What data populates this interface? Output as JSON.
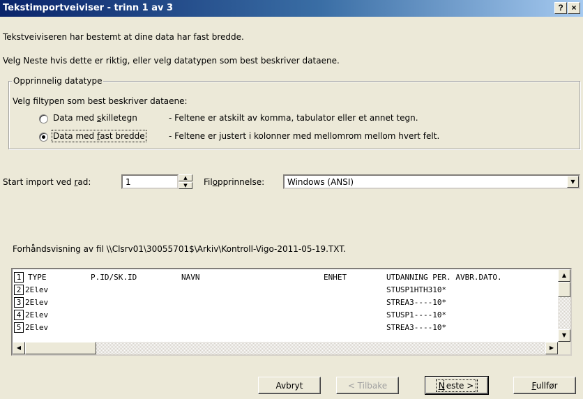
{
  "window": {
    "title": "Tekstimportveiviser - trinn 1 av 3",
    "help_label": "?",
    "close_label": "×"
  },
  "intro": {
    "line1": "Tekstveiviseren har bestemt at dine data har fast bredde.",
    "line2": "Velg Neste hvis dette er riktig, eller velg datatypen som best beskriver dataene."
  },
  "datatype_group": {
    "legend": "Opprinnelig datatype",
    "prompt": "Velg filtypen som best beskriver dataene:",
    "options": [
      {
        "label_pre": "Data med ",
        "label_mnemonic": "s",
        "label_post": "killetegn",
        "description": "- Feltene er atskilt av komma, tabulator eller et annet tegn.",
        "selected": false
      },
      {
        "label_pre": "Data med ",
        "label_mnemonic": "f",
        "label_post": "ast bredde",
        "description": "- Feltene er justert i kolonner med mellomrom mellom hvert felt.",
        "selected": true
      }
    ]
  },
  "start_row": {
    "label_pre": "Start import ved ",
    "label_mnemonic": "r",
    "label_post": "ad:",
    "value": "1"
  },
  "file_origin": {
    "label_pre": "Fil",
    "label_mnemonic": "o",
    "label_post": "pprinnelse:",
    "value": "Windows (ANSI)"
  },
  "preview": {
    "label": "Forhåndsvisning av fil \\\\Clsrv01\\30055701$\\Arkiv\\Kontroll-Vigo-2011-05-19.TXT.",
    "header": {
      "num": "1",
      "c1": "TYPE",
      "c2": "P.ID/SK.ID",
      "c3": "NAVN",
      "c4": "ENHET",
      "c5": "UTDANNING PER. AVBR.DATO."
    },
    "rows": [
      {
        "num": "2",
        "c1": "2Elev",
        "c5": "STUSP1HTH310*"
      },
      {
        "num": "3",
        "c1": "2Elev",
        "c5": "STREA3----10*"
      },
      {
        "num": "4",
        "c1": "2Elev",
        "c5": "STUSP1----10*"
      },
      {
        "num": "5",
        "c1": "2Elev",
        "c5": "STREA3----10*"
      }
    ]
  },
  "buttons": {
    "cancel": "Avbryt",
    "back": "< Tilbake",
    "next_mnemonic": "N",
    "next_post": "este >",
    "finish_mnemonic": "F",
    "finish_post": "ullfør"
  }
}
